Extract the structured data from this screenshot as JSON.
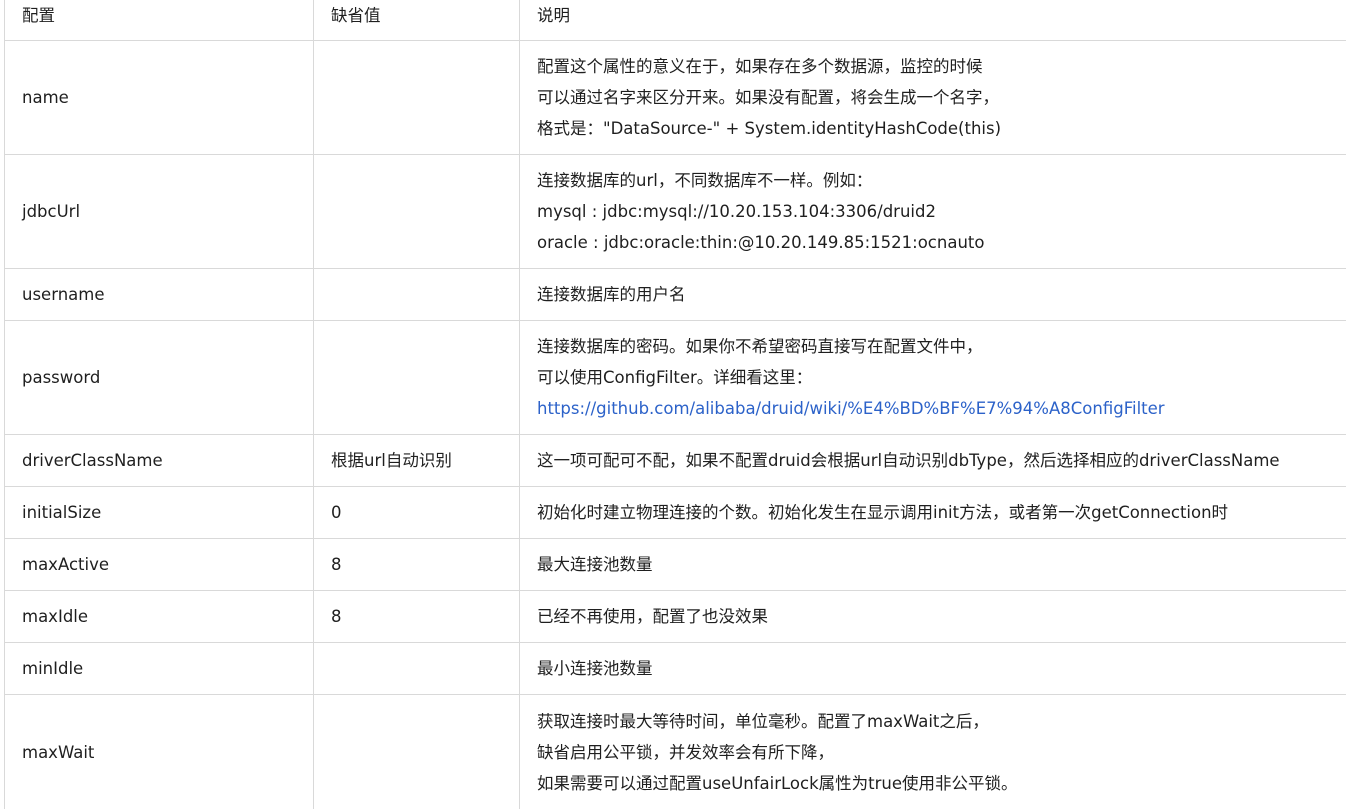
{
  "header": {
    "col1": "配置",
    "col2": "缺省值",
    "col3": "说明"
  },
  "rows": [
    {
      "name": "name",
      "default": "",
      "desc": [
        "配置这个属性的意义在于，如果存在多个数据源，监控的时候",
        "可以通过名字来区分开来。如果没有配置，将会生成一个名字，",
        "格式是：\"DataSource-\" + System.identityHashCode(this)"
      ]
    },
    {
      "name": "jdbcUrl",
      "default": "",
      "desc": [
        "连接数据库的url，不同数据库不一样。例如：",
        "mysql : jdbc:mysql://10.20.153.104:3306/druid2",
        "oracle : jdbc:oracle:thin:@10.20.149.85:1521:ocnauto"
      ]
    },
    {
      "name": "username",
      "default": "",
      "desc": [
        "连接数据库的用户名"
      ]
    },
    {
      "name": "password",
      "default": "",
      "desc": [
        "连接数据库的密码。如果你不希望密码直接写在配置文件中，",
        "可以使用ConfigFilter。详细看这里："
      ],
      "link": "https://github.com/alibaba/druid/wiki/%E4%BD%BF%E7%94%A8ConfigFilter"
    },
    {
      "name": "driverClassName",
      "default": "根据url自动识别",
      "desc": [
        "这一项可配可不配，如果不配置druid会根据url自动识别dbType，然后选择相应的driverClassName"
      ]
    },
    {
      "name": "initialSize",
      "default": "0",
      "desc": [
        "初始化时建立物理连接的个数。初始化发生在显示调用init方法，或者第一次getConnection时"
      ]
    },
    {
      "name": "maxActive",
      "default": "8",
      "desc": [
        "最大连接池数量"
      ]
    },
    {
      "name": "maxIdle",
      "default": "8",
      "desc": [
        "已经不再使用，配置了也没效果"
      ]
    },
    {
      "name": "minIdle",
      "default": "",
      "desc": [
        "最小连接池数量"
      ]
    },
    {
      "name": "maxWait",
      "default": "",
      "desc": [
        "获取连接时最大等待时间，单位毫秒。配置了maxWait之后，",
        "缺省启用公平锁，并发效率会有所下降，",
        "如果需要可以通过配置useUnfairLock属性为true使用非公平锁。"
      ]
    }
  ],
  "colors": {
    "link": "#2c62c9",
    "border": "#d9d9d9"
  }
}
